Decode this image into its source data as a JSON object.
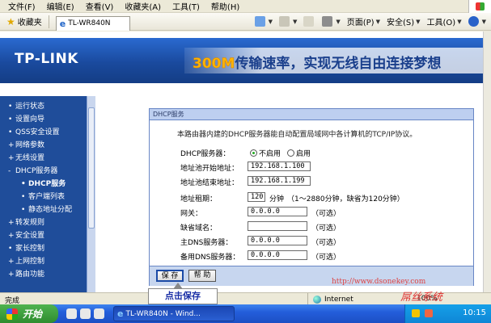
{
  "menu": {
    "items": [
      "文件(F)",
      "编辑(E)",
      "查看(V)",
      "收藏夹(A)",
      "工具(T)",
      "帮助(H)"
    ]
  },
  "toolbar": {
    "favorites_label": "收藏夹",
    "tab_title": "TL-WR840N",
    "page_label": "页面(P)",
    "safety_label": "安全(S)",
    "tools_label": "工具(O)"
  },
  "banner": {
    "logo": "TP-LINK",
    "slogan_highlight": "300M",
    "slogan_rest": "传输速率，实现无线自由连接梦想"
  },
  "sidebar": {
    "items": [
      {
        "label": "运行状态",
        "bullet": "•"
      },
      {
        "label": "设置向导",
        "bullet": "•"
      },
      {
        "label": "QSS安全设置",
        "bullet": "•"
      },
      {
        "label": "网络参数",
        "bullet": "+"
      },
      {
        "label": "无线设置",
        "bullet": "+"
      },
      {
        "label": "DHCP服务器",
        "bullet": "-"
      },
      {
        "label": "DHCP服务",
        "bullet": "•",
        "sub": true,
        "active": true
      },
      {
        "label": "客户端列表",
        "bullet": "•",
        "sub": true
      },
      {
        "label": "静态地址分配",
        "bullet": "•",
        "sub": true
      },
      {
        "label": "转发规则",
        "bullet": "+"
      },
      {
        "label": "安全设置",
        "bullet": "+"
      },
      {
        "label": "家长控制",
        "bullet": "•"
      },
      {
        "label": "上网控制",
        "bullet": "+"
      },
      {
        "label": "路由功能",
        "bullet": "+"
      }
    ]
  },
  "panel": {
    "title": "DHCP服务",
    "description": "本路由器内建的DHCP服务器能自动配置局域网中各计算机的TCP/IP协议。",
    "dhcp_label": "DHCP服务器：",
    "disable_label": "不启用",
    "enable_label": "启用",
    "selected": "disable",
    "start_label": "地址池开始地址：",
    "start_value": "192.168.1.100",
    "end_label": "地址池结束地址：",
    "end_value": "192.168.1.199",
    "lease_label": "地址租期：",
    "lease_value": "120",
    "lease_unit": "分钟",
    "lease_hint": "（1～2880分钟，缺省为120分钟）",
    "gateway_label": "网关：",
    "gateway_value": "0.0.0.0",
    "domain_label": "缺省域名：",
    "domain_value": "",
    "dns1_label": "主DNS服务器：",
    "dns1_value": "0.0.0.0",
    "dns2_label": "备用DNS服务器：",
    "dns2_value": "0.0.0.0",
    "optional": "（可选）",
    "save_label": "保 存",
    "help_label": "帮 助"
  },
  "callout": "点击保存",
  "watermark_url": "http://www.dsonekey.com",
  "watermark_brand": "屌丝系统",
  "status": {
    "left": "完成",
    "zone": "Internet",
    "zoom": "100%"
  },
  "taskbar": {
    "start_label": "开始",
    "task_title": "TL-WR840N - Wind...",
    "clock": "10:15"
  },
  "colors": {
    "sidebar_bg": "#1f4d9a",
    "panel_border": "#6886c5",
    "callout_text": "#1a2fa6",
    "brand_watermark": "#e03030"
  }
}
